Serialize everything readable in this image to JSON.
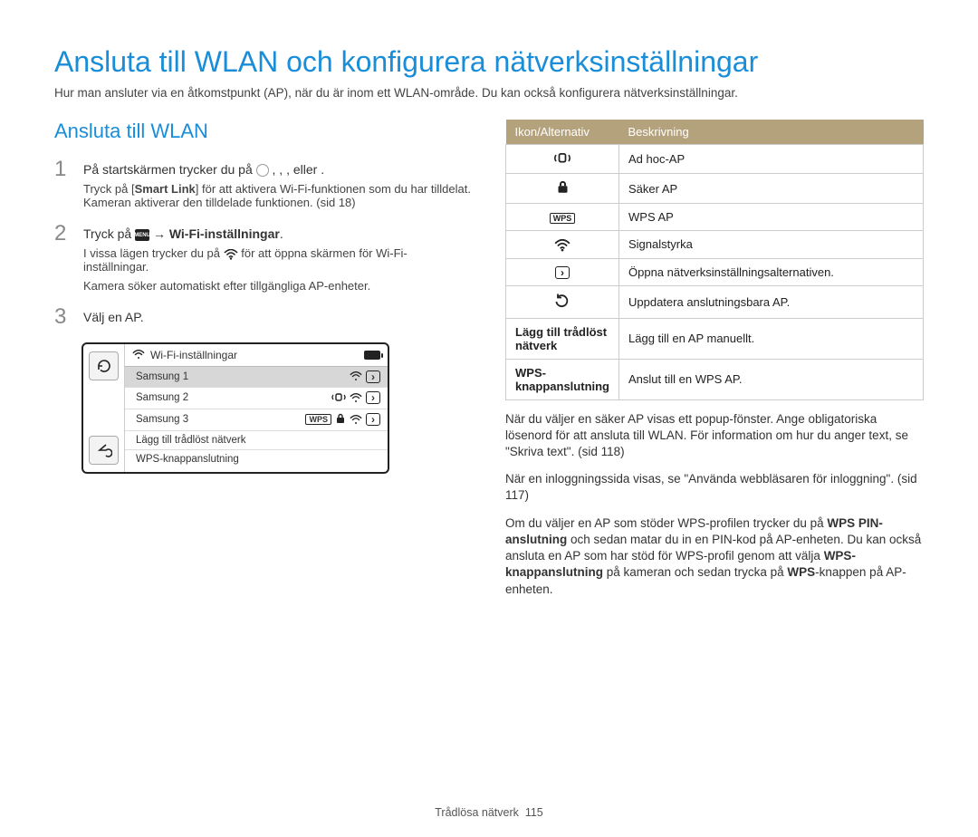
{
  "title": "Ansluta till WLAN och konfigurera nätverksinställningar",
  "intro": "Hur man ansluter via en åtkomstpunkt (AP), när du är inom ett WLAN-område. Du kan också konfigurera nätverksinställningar.",
  "subtitle": "Ansluta till WLAN",
  "steps": {
    "s1": {
      "num": "1",
      "pre": "På startskärmen trycker du på ",
      "mid1": ",   ,   ,   ",
      "post": "eller   .",
      "note_a": "Tryck på [",
      "note_b": "Smart Link",
      "note_c": "] för att aktivera Wi-Fi-funktionen som du har tilldelat. Kameran aktiverar den tilldelade funktionen. (sid 18)"
    },
    "s2": {
      "num": "2",
      "pre": "Tryck på ",
      "arrow": " → ",
      "bold": "Wi-Fi-inställningar",
      "dot": ".",
      "note_a": "I vissa lägen trycker du på ",
      "note_b": " för att öppna skärmen för Wi-Fi-inställningar.",
      "note_c": "Kamera söker automatiskt efter tillgängliga AP-enheter."
    },
    "s3": {
      "num": "3",
      "text": "Välj en AP."
    }
  },
  "device": {
    "header": "Wi-Fi-inställningar",
    "rows": [
      {
        "label": "Samsung 1"
      },
      {
        "label": "Samsung 2"
      },
      {
        "label": "Samsung 3"
      },
      {
        "label": "Lägg till trådlöst nätverk"
      },
      {
        "label": "WPS-knappanslutning"
      }
    ]
  },
  "table": {
    "h1": "Ikon/Alternativ",
    "h2": "Beskrivning",
    "rows": [
      {
        "desc": "Ad hoc-AP"
      },
      {
        "desc": "Säker AP"
      },
      {
        "desc": "WPS AP"
      },
      {
        "desc": "Signalstyrka"
      },
      {
        "desc": "Öppna nätverksinställningsalternativen."
      },
      {
        "desc": "Uppdatera anslutningsbara AP."
      },
      {
        "label": "Lägg till trådlöst nätverk",
        "desc": "Lägg till en AP manuellt."
      },
      {
        "label": "WPS-knappanslutning",
        "desc": "Anslut till en WPS AP."
      }
    ]
  },
  "right": {
    "p1a": "När du väljer en säker AP visas ett popup-fönster. Ange obligatoriska lösenord för att ansluta till WLAN. För information om hur du anger text, se \"Skriva text\". (sid 118)",
    "p2a": "När en inloggningssida visas, se \"Använda webbläsaren för inloggning\". (sid 117)",
    "p3a": "Om du väljer en AP som stöder WPS-profilen trycker du på ",
    "p3b": "WPS PIN-anslutning",
    "p3c": " och sedan matar du in en PIN-kod på AP-enheten. Du kan också ansluta en AP som har stöd för WPS-profil genom att välja ",
    "p3d": "WPS-knappanslutning",
    "p3e": " på kameran och sedan trycka på ",
    "p3f": "WPS",
    "p3g": "-knappen på AP-enheten."
  },
  "footer": {
    "section": "Trådlösa nätverk",
    "page": "115"
  }
}
